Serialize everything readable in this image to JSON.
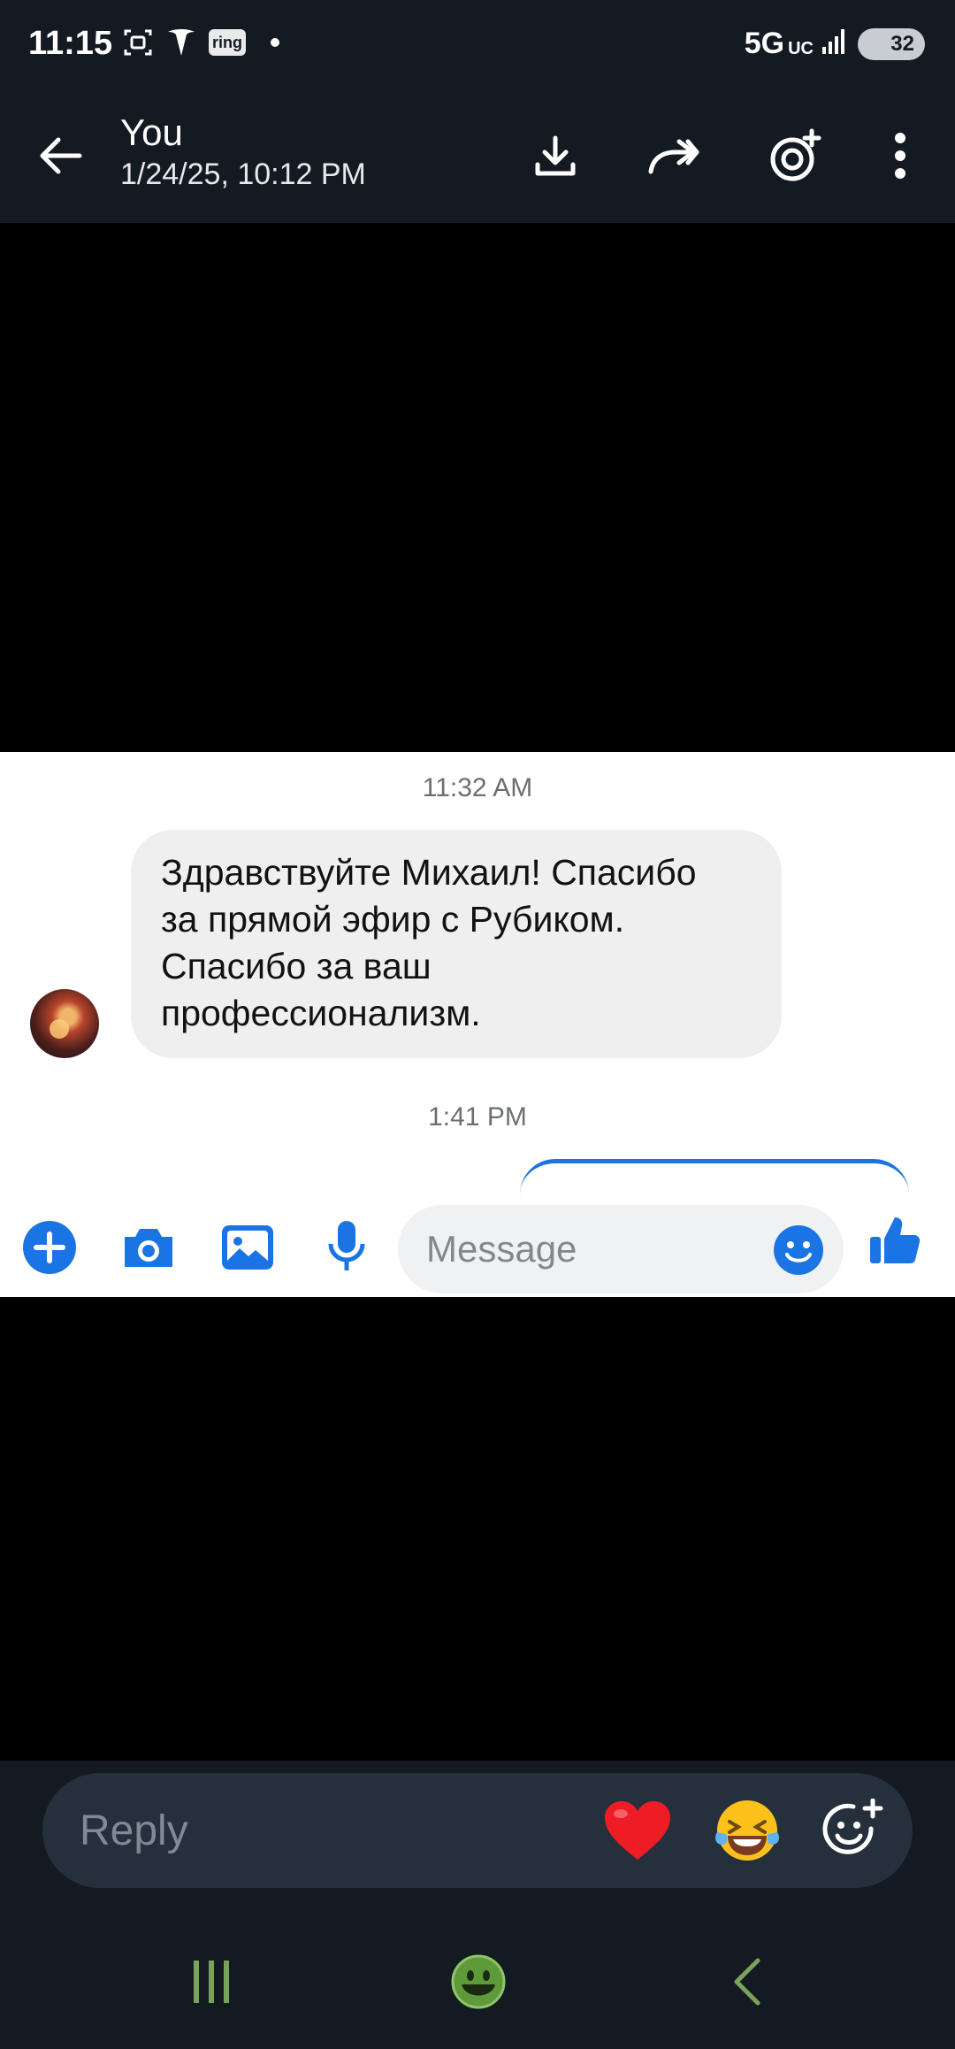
{
  "status_bar": {
    "time": "11:15",
    "ring_label": "ring",
    "network": "5G",
    "network_sub": "UC",
    "battery": "32"
  },
  "app_bar": {
    "sender": "You",
    "date": "1/24/25, 10:12 PM"
  },
  "conversation": {
    "timestamp_1": "11:32 AM",
    "message_lines": [
      "Здравствуйте Михаил! Спасибо",
      "за прямой эфир с Рубиком.",
      "Спасибо за ваш",
      "профессионализм."
    ],
    "timestamp_2": "1:41 PM"
  },
  "composer": {
    "placeholder": "Message"
  },
  "reply": {
    "placeholder": "Reply",
    "reaction_1": "❤️",
    "reaction_2": "😂"
  },
  "colors": {
    "dark_bg": "#141a21",
    "messenger_blue": "#1b74e4",
    "nav_green": "#7aa35a"
  }
}
